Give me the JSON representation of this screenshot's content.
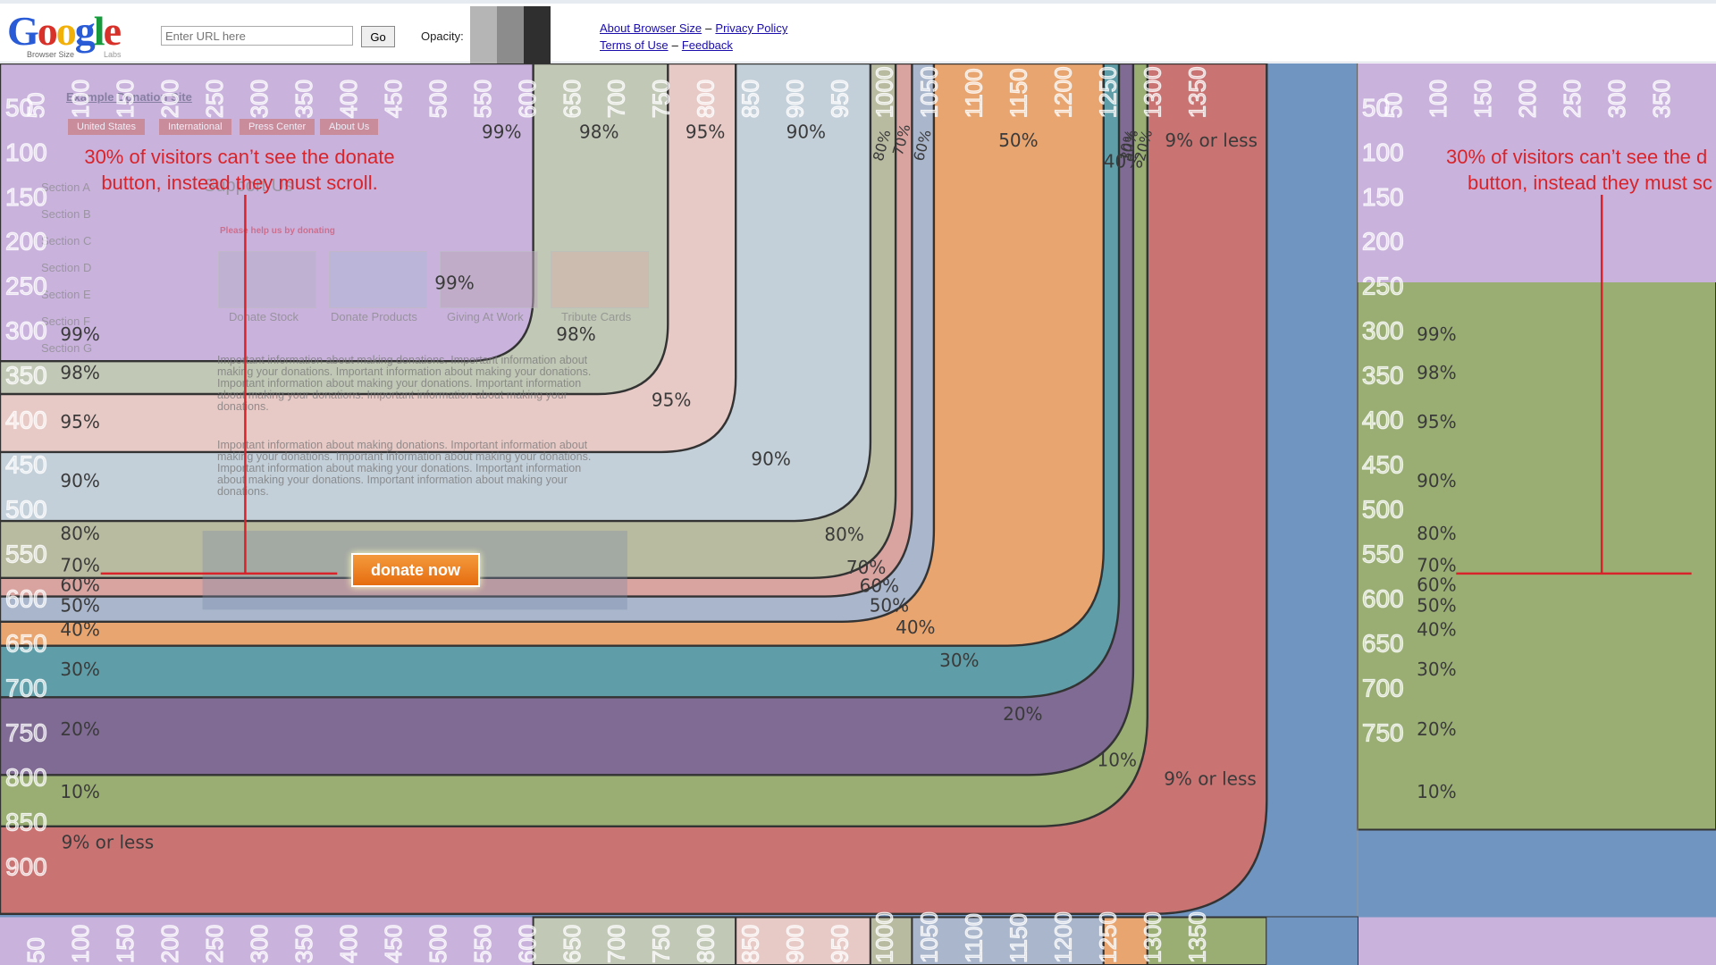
{
  "header": {
    "logo_text": "Google",
    "logo_sub": "Browser Size",
    "logo_labs": "Labs",
    "url_placeholder": "Enter URL here",
    "go_label": "Go",
    "opacity_label": "Opacity:",
    "opacity_swatches": [
      "#b5b5b5",
      "#8c8c8c",
      "#2f2f2f"
    ],
    "links": {
      "about": "About Browser Size",
      "privacy": "Privacy Policy",
      "terms": "Terms of Use",
      "feedback": "Feedback"
    }
  },
  "ruler": {
    "x_labels": [
      "50",
      "100",
      "150",
      "200",
      "250",
      "300",
      "350",
      "400",
      "450",
      "500",
      "550",
      "600",
      "650",
      "700",
      "750",
      "800",
      "850",
      "900",
      "950",
      "1000",
      "1050",
      "1100",
      "1150",
      "1200",
      "1250",
      "1300",
      "1350"
    ],
    "y_labels": [
      "50",
      "100",
      "150",
      "200",
      "250",
      "300",
      "350",
      "400",
      "450",
      "500",
      "550",
      "600",
      "650",
      "700",
      "750",
      "800",
      "850",
      "900"
    ]
  },
  "overlay_pct": {
    "left": [
      "99%",
      "98%",
      "95%",
      "90%",
      "80%",
      "70%",
      "60%",
      "50%",
      "40%",
      "30%",
      "20%",
      "10%",
      "9% or less"
    ],
    "top": [
      "99%",
      "98%",
      "95%",
      "90%",
      "80%",
      "70%",
      "60%",
      "50%",
      "40%",
      "30%",
      "20%",
      "10%",
      "9% or less"
    ],
    "inner": [
      "99%",
      "98%",
      "95%",
      "90%",
      "80%",
      "70%",
      "60%",
      "50%",
      "40%",
      "30%",
      "20%",
      "10%",
      "9% or less"
    ]
  },
  "ghost_site": {
    "title": "Example Donation Site",
    "nav": [
      "United States",
      "International",
      "Press Center",
      "About Us"
    ],
    "sidebar": [
      "Section A",
      "Section B",
      "Section C",
      "Section D",
      "Section E",
      "Section F",
      "Section G"
    ],
    "heading": "Support Us",
    "subheading": "Please help us by donating",
    "captions": [
      "Donate Stock",
      "Donate Products",
      "Giving At Work",
      "Tribute Cards"
    ],
    "para1": "Important information about making donations. Important information about making your donations. Important information about making your donations. Important information about making your donations. Important information about making your donations. Important information about making your donations.",
    "para2": "Important information about making donations. Important information about making your donations. Important information about making your donations. Important information about making your donations. Important information about making your donations. Important information about making your donations.",
    "donate_label": "donate now"
  },
  "annotation": {
    "line1": "30% of visitors can’t see the donate",
    "line2": "button, instead they must scroll.",
    "right_line1": "30% of visitors can’t see the d",
    "right_line2": "button, instead they must sc"
  },
  "band_colors": [
    "#c9b3dd",
    "#c1c8b6",
    "#e7c9c6",
    "#c3cfd9",
    "#b9bba1",
    "#d9a3a0",
    "#a9b6cc",
    "#e9a56f",
    "#5f9ea8",
    "#7f6b93",
    "#9aae74",
    "#c97473",
    "#6f95c0"
  ]
}
